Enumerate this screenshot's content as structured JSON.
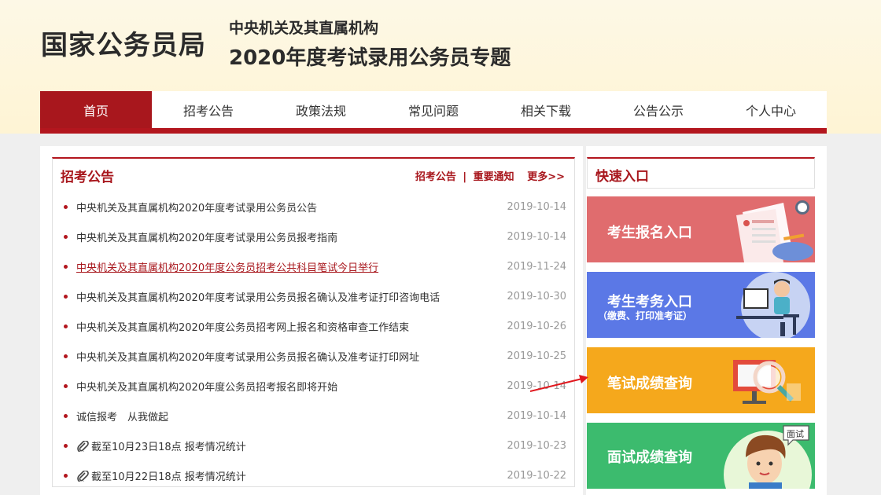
{
  "header": {
    "site_name": "国家公务员局",
    "subtitle_line1": "中央机关及其直属机构",
    "subtitle_line2": "2020年度考试录用公务员专题"
  },
  "nav": {
    "items": [
      "首页",
      "招考公告",
      "政策法规",
      "常见问题",
      "相关下载",
      "公告公示",
      "个人中心"
    ],
    "active_index": 0
  },
  "news": {
    "title": "招考公告",
    "link1": "招考公告",
    "sep": "|",
    "link2": "重要通知",
    "more": "更多>>",
    "items": [
      {
        "text": "中央机关及其直属机构2020年度考试录用公务员公告",
        "date": "2019-10-14"
      },
      {
        "text": "中央机关及其直属机构2020年度考试录用公务员报考指南",
        "date": "2019-10-14"
      },
      {
        "text": "中央机关及其直属机构2020年度公务员招考公共科目笔试今日举行",
        "date": "2019-11-24"
      },
      {
        "text": "中央机关及其直属机构2020年度考试录用公务员报名确认及准考证打印咨询电话",
        "date": "2019-10-30"
      },
      {
        "text": "中央机关及其直属机构2020年度公务员招考网上报名和资格审查工作结束",
        "date": "2019-10-26"
      },
      {
        "text": "中央机关及其直属机构2020年度考试录用公务员报名确认及准考证打印网址",
        "date": "2019-10-25"
      },
      {
        "text": "中央机关及其直属机构2020年度公务员招考报名即将开始",
        "date": "2019-10-14"
      },
      {
        "text": "诚信报考　从我做起",
        "date": "2019-10-14"
      },
      {
        "text": "截至10月23日18点 报考情况统计",
        "date": "2019-10-23"
      },
      {
        "text": "截至10月22日18点 报考情况统计",
        "date": "2019-10-22"
      }
    ]
  },
  "quick": {
    "title": "快速入口",
    "cards": [
      {
        "label": "考生报名入口",
        "color": "#e06c6e"
      },
      {
        "label": "考生考务入口",
        "sub": "（缴费、打印准考证）",
        "color": "#5b78e6"
      },
      {
        "label": "笔试成绩查询",
        "color": "#f5a81c"
      },
      {
        "label": "面试成绩查询",
        "color": "#3cbb6e"
      }
    ],
    "bubble": "面试"
  },
  "colors": {
    "accent": "#b3161e",
    "header_bg": "#fef6dc"
  }
}
